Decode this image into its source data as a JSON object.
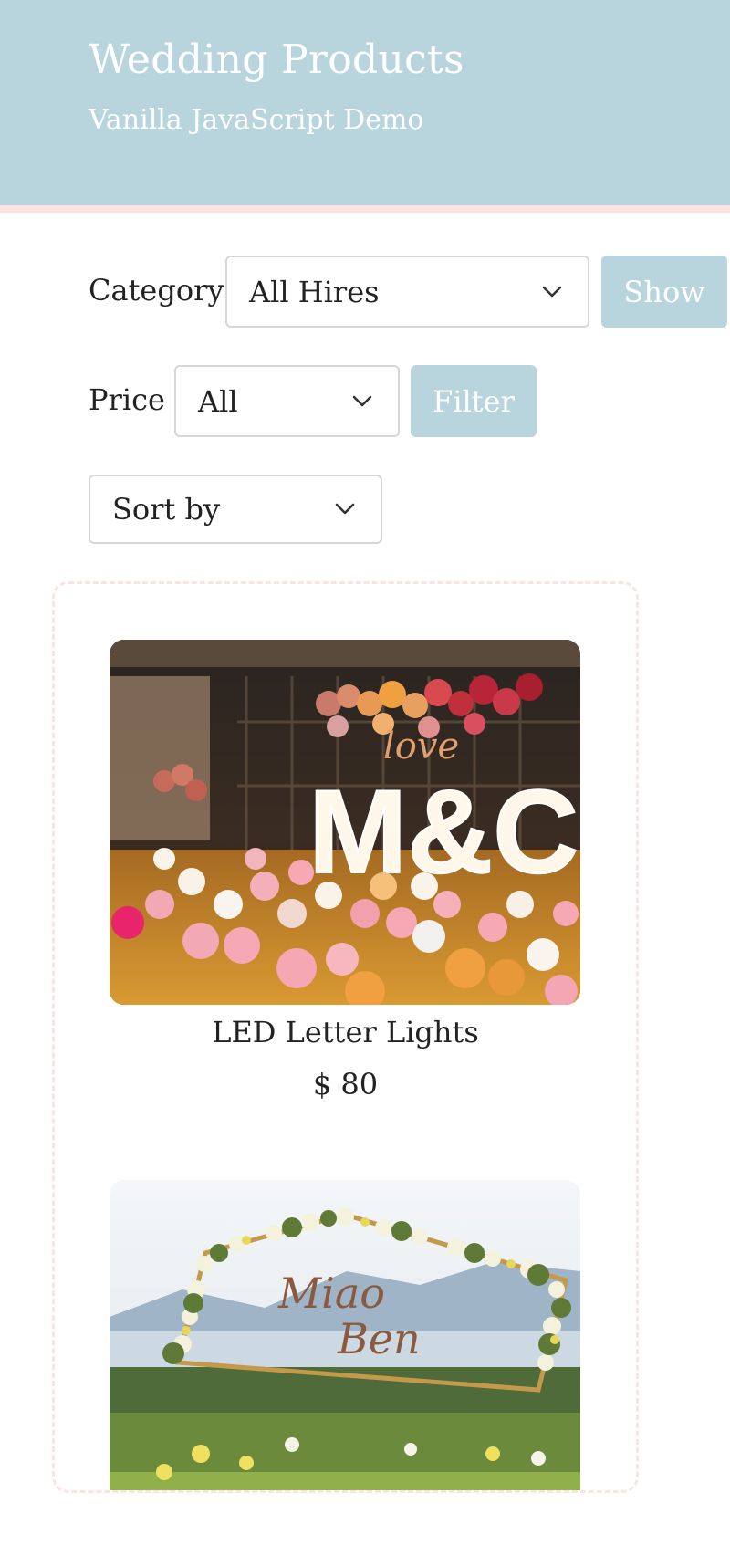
{
  "header": {
    "title": "Wedding Products",
    "subtitle": "Vanilla JavaScript Demo"
  },
  "filters": {
    "category_label": "Category",
    "category_value": "All Hires",
    "show_button": "Show",
    "price_label": "Price",
    "price_value": "All",
    "filter_button": "Filter",
    "sort_value": "Sort by"
  },
  "products": [
    {
      "name": "LED Letter Lights",
      "price": "$ 80",
      "image": "led-letter-lights-photo"
    },
    {
      "name": "",
      "price": "",
      "image": "floral-arch-photo"
    }
  ],
  "colors": {
    "header_bg": "#b8d5de",
    "accent_border": "#fde2e4",
    "button_bg": "#b8d5de"
  },
  "icons": {
    "select_arrow": "chevron-down-icon"
  }
}
